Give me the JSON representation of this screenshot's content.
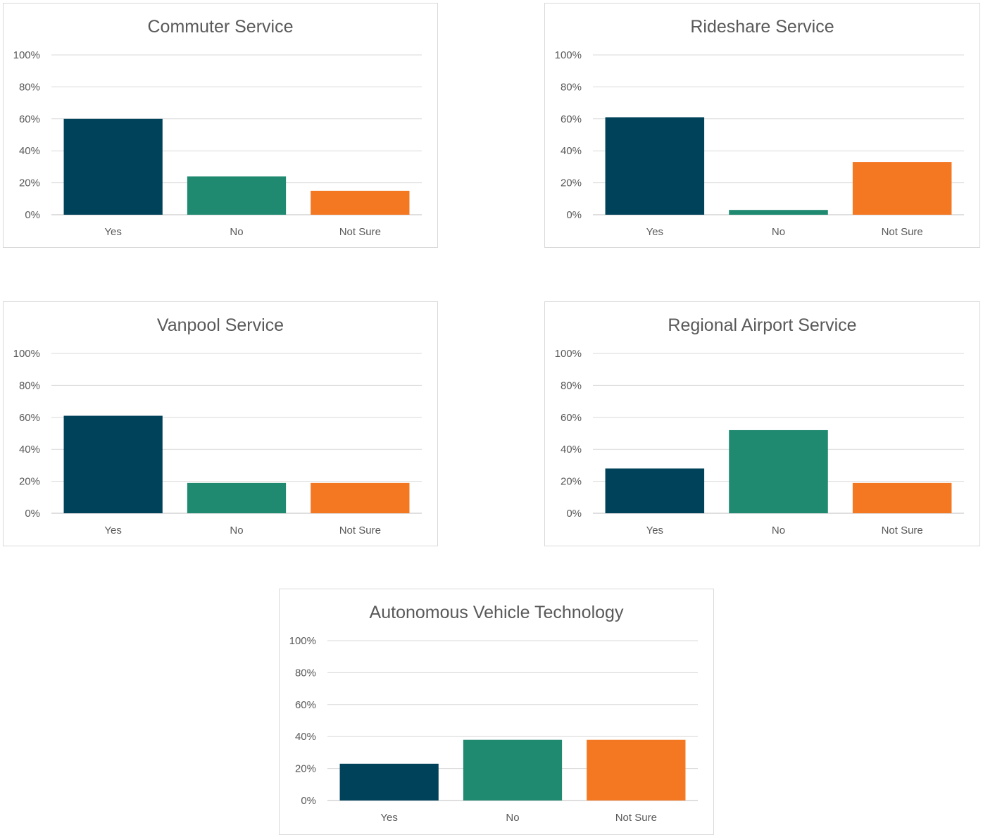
{
  "colors": {
    "yes": "#00425a",
    "no": "#1f8a70",
    "not_sure": "#f47721",
    "grid": "#d9d9d9",
    "axis": "#bfbfbf",
    "text": "#595959"
  },
  "chart_data": [
    {
      "type": "bar",
      "title": "Commuter Service",
      "categories": [
        "Yes",
        "No",
        "Not Sure"
      ],
      "values": [
        60,
        24,
        15
      ],
      "yticks": [
        "0%",
        "20%",
        "40%",
        "60%",
        "80%",
        "100%"
      ],
      "ylim": [
        0,
        100
      ],
      "grid": true
    },
    {
      "type": "bar",
      "title": "Rideshare Service",
      "categories": [
        "Yes",
        "No",
        "Not Sure"
      ],
      "values": [
        61,
        3,
        33
      ],
      "yticks": [
        "0%",
        "20%",
        "40%",
        "60%",
        "80%",
        "100%"
      ],
      "ylim": [
        0,
        100
      ],
      "grid": true
    },
    {
      "type": "bar",
      "title": "Vanpool Service",
      "categories": [
        "Yes",
        "No",
        "Not Sure"
      ],
      "values": [
        61,
        19,
        19
      ],
      "yticks": [
        "0%",
        "20%",
        "40%",
        "60%",
        "80%",
        "100%"
      ],
      "ylim": [
        0,
        100
      ],
      "grid": true
    },
    {
      "type": "bar",
      "title": "Regional Airport Service",
      "categories": [
        "Yes",
        "No",
        "Not Sure"
      ],
      "values": [
        28,
        52,
        19
      ],
      "yticks": [
        "0%",
        "20%",
        "40%",
        "60%",
        "80%",
        "100%"
      ],
      "ylim": [
        0,
        100
      ],
      "grid": true
    },
    {
      "type": "bar",
      "title": "Autonomous Vehicle Technology",
      "categories": [
        "Yes",
        "No",
        "Not Sure"
      ],
      "values": [
        23,
        38,
        38
      ],
      "yticks": [
        "0%",
        "20%",
        "40%",
        "60%",
        "80%",
        "100%"
      ],
      "ylim": [
        0,
        100
      ],
      "grid": true
    }
  ]
}
